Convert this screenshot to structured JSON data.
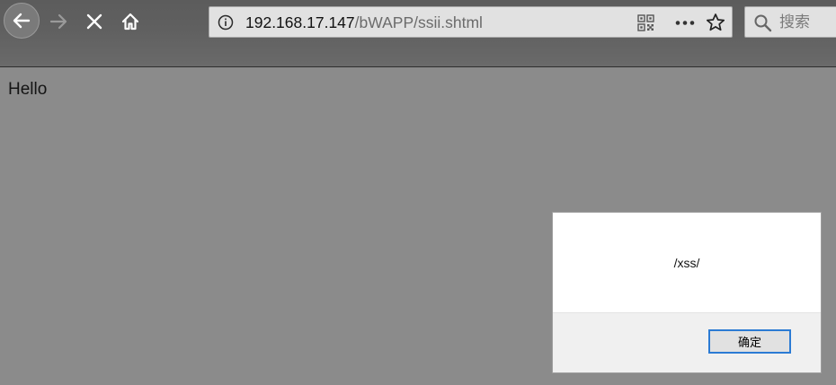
{
  "browser": {
    "nav": {
      "back_icon": "arrow-left-icon",
      "forward_icon": "arrow-right-icon",
      "stop_icon": "close-icon",
      "home_icon": "home-icon"
    },
    "address_bar": {
      "host": "192.168.17.147",
      "path": "/bWAPP/ssii.shtml",
      "icons": [
        "info-icon",
        "qr-code-icon",
        "more-icon",
        "star-icon"
      ]
    },
    "search": {
      "placeholder": "搜索",
      "icon": "search-icon"
    }
  },
  "page": {
    "text": "Hello"
  },
  "alert": {
    "message": "/xss/",
    "ok_label": "确定",
    "accent": "#2b7bd4"
  }
}
